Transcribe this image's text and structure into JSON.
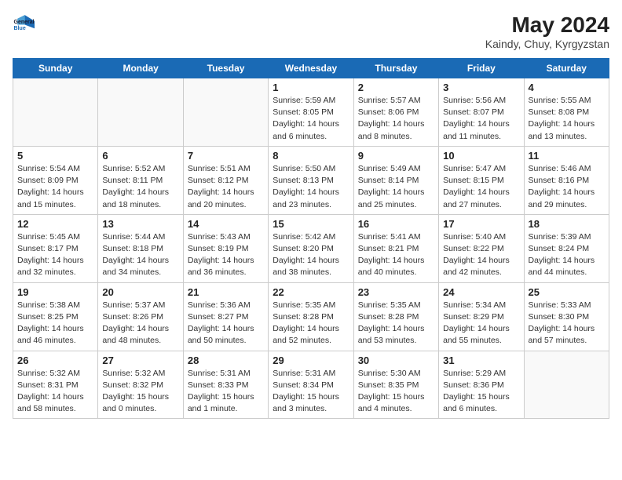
{
  "header": {
    "logo_line1": "General",
    "logo_line2": "Blue",
    "title": "May 2024",
    "subtitle": "Kaindy, Chuy, Kyrgyzstan"
  },
  "weekdays": [
    "Sunday",
    "Monday",
    "Tuesday",
    "Wednesday",
    "Thursday",
    "Friday",
    "Saturday"
  ],
  "weeks": [
    [
      {
        "day": null
      },
      {
        "day": null
      },
      {
        "day": null
      },
      {
        "day": "1",
        "info": "Sunrise: 5:59 AM\nSunset: 8:05 PM\nDaylight: 14 hours\nand 6 minutes."
      },
      {
        "day": "2",
        "info": "Sunrise: 5:57 AM\nSunset: 8:06 PM\nDaylight: 14 hours\nand 8 minutes."
      },
      {
        "day": "3",
        "info": "Sunrise: 5:56 AM\nSunset: 8:07 PM\nDaylight: 14 hours\nand 11 minutes."
      },
      {
        "day": "4",
        "info": "Sunrise: 5:55 AM\nSunset: 8:08 PM\nDaylight: 14 hours\nand 13 minutes."
      }
    ],
    [
      {
        "day": "5",
        "info": "Sunrise: 5:54 AM\nSunset: 8:09 PM\nDaylight: 14 hours\nand 15 minutes."
      },
      {
        "day": "6",
        "info": "Sunrise: 5:52 AM\nSunset: 8:11 PM\nDaylight: 14 hours\nand 18 minutes."
      },
      {
        "day": "7",
        "info": "Sunrise: 5:51 AM\nSunset: 8:12 PM\nDaylight: 14 hours\nand 20 minutes."
      },
      {
        "day": "8",
        "info": "Sunrise: 5:50 AM\nSunset: 8:13 PM\nDaylight: 14 hours\nand 23 minutes."
      },
      {
        "day": "9",
        "info": "Sunrise: 5:49 AM\nSunset: 8:14 PM\nDaylight: 14 hours\nand 25 minutes."
      },
      {
        "day": "10",
        "info": "Sunrise: 5:47 AM\nSunset: 8:15 PM\nDaylight: 14 hours\nand 27 minutes."
      },
      {
        "day": "11",
        "info": "Sunrise: 5:46 AM\nSunset: 8:16 PM\nDaylight: 14 hours\nand 29 minutes."
      }
    ],
    [
      {
        "day": "12",
        "info": "Sunrise: 5:45 AM\nSunset: 8:17 PM\nDaylight: 14 hours\nand 32 minutes."
      },
      {
        "day": "13",
        "info": "Sunrise: 5:44 AM\nSunset: 8:18 PM\nDaylight: 14 hours\nand 34 minutes."
      },
      {
        "day": "14",
        "info": "Sunrise: 5:43 AM\nSunset: 8:19 PM\nDaylight: 14 hours\nand 36 minutes."
      },
      {
        "day": "15",
        "info": "Sunrise: 5:42 AM\nSunset: 8:20 PM\nDaylight: 14 hours\nand 38 minutes."
      },
      {
        "day": "16",
        "info": "Sunrise: 5:41 AM\nSunset: 8:21 PM\nDaylight: 14 hours\nand 40 minutes."
      },
      {
        "day": "17",
        "info": "Sunrise: 5:40 AM\nSunset: 8:22 PM\nDaylight: 14 hours\nand 42 minutes."
      },
      {
        "day": "18",
        "info": "Sunrise: 5:39 AM\nSunset: 8:24 PM\nDaylight: 14 hours\nand 44 minutes."
      }
    ],
    [
      {
        "day": "19",
        "info": "Sunrise: 5:38 AM\nSunset: 8:25 PM\nDaylight: 14 hours\nand 46 minutes."
      },
      {
        "day": "20",
        "info": "Sunrise: 5:37 AM\nSunset: 8:26 PM\nDaylight: 14 hours\nand 48 minutes."
      },
      {
        "day": "21",
        "info": "Sunrise: 5:36 AM\nSunset: 8:27 PM\nDaylight: 14 hours\nand 50 minutes."
      },
      {
        "day": "22",
        "info": "Sunrise: 5:35 AM\nSunset: 8:28 PM\nDaylight: 14 hours\nand 52 minutes."
      },
      {
        "day": "23",
        "info": "Sunrise: 5:35 AM\nSunset: 8:28 PM\nDaylight: 14 hours\nand 53 minutes."
      },
      {
        "day": "24",
        "info": "Sunrise: 5:34 AM\nSunset: 8:29 PM\nDaylight: 14 hours\nand 55 minutes."
      },
      {
        "day": "25",
        "info": "Sunrise: 5:33 AM\nSunset: 8:30 PM\nDaylight: 14 hours\nand 57 minutes."
      }
    ],
    [
      {
        "day": "26",
        "info": "Sunrise: 5:32 AM\nSunset: 8:31 PM\nDaylight: 14 hours\nand 58 minutes."
      },
      {
        "day": "27",
        "info": "Sunrise: 5:32 AM\nSunset: 8:32 PM\nDaylight: 15 hours\nand 0 minutes."
      },
      {
        "day": "28",
        "info": "Sunrise: 5:31 AM\nSunset: 8:33 PM\nDaylight: 15 hours\nand 1 minute."
      },
      {
        "day": "29",
        "info": "Sunrise: 5:31 AM\nSunset: 8:34 PM\nDaylight: 15 hours\nand 3 minutes."
      },
      {
        "day": "30",
        "info": "Sunrise: 5:30 AM\nSunset: 8:35 PM\nDaylight: 15 hours\nand 4 minutes."
      },
      {
        "day": "31",
        "info": "Sunrise: 5:29 AM\nSunset: 8:36 PM\nDaylight: 15 hours\nand 6 minutes."
      },
      {
        "day": null
      }
    ]
  ]
}
